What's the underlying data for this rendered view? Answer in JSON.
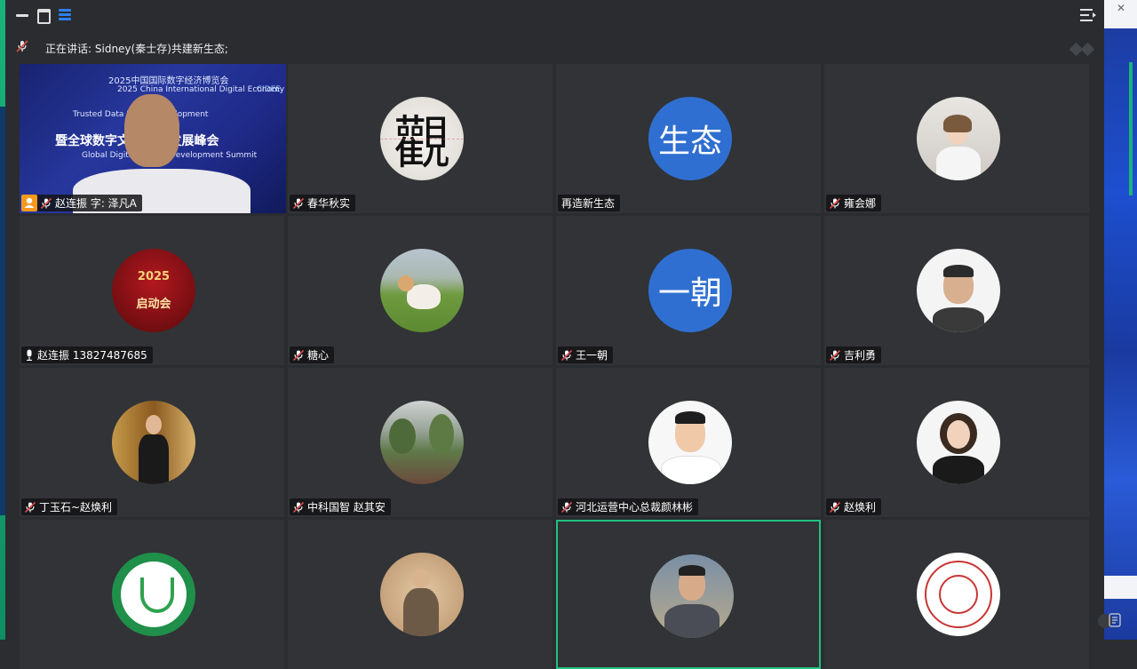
{
  "speaker_bar": {
    "prefix": "正在讲话:",
    "speaker": "Sidney(秦士存)共建新生态;"
  },
  "video_overlay": {
    "line1": "2025中国国际数字经济博览会",
    "line2": "2025 China International Digital Economy Expo",
    "line3": "Trusted Data Emp... Development",
    "line4": "暨全球数字文...(A) 发展峰会",
    "line5": "Global Digital Cultu... Development Summit",
    "logo": "CIDEE"
  },
  "participants": [
    {
      "name": "赵连振 字: 泽凡A",
      "avatar": "video",
      "mic": "off",
      "host": true
    },
    {
      "name": "春华秋实",
      "avatar": "calligraphy",
      "avatar_text": "觀",
      "mic": "off"
    },
    {
      "name": "再造新生态",
      "avatar": "initials",
      "avatar_text": "生态",
      "avatar_color": "#2f6fd1",
      "mic": "none"
    },
    {
      "name": "雍会娜",
      "avatar": "photo-woman",
      "mic": "off"
    },
    {
      "name": "赵连振 13827487685",
      "avatar": "poster",
      "avatar_text": "2025",
      "avatar_sub": "启动会",
      "mic": "on"
    },
    {
      "name": "糖心",
      "avatar": "photo-dog",
      "mic": "off"
    },
    {
      "name": "王一朝",
      "avatar": "initials",
      "avatar_text": "一朝",
      "avatar_color": "#2f6fd1",
      "mic": "off"
    },
    {
      "name": "吉利勇",
      "avatar": "photo-man",
      "mic": "off"
    },
    {
      "name": "丁玉石~赵焕利",
      "avatar": "photo-suit",
      "mic": "off"
    },
    {
      "name": "中科国智  赵其安",
      "avatar": "photo-garden",
      "mic": "off"
    },
    {
      "name": "河北运营中心总裁颜林彬",
      "avatar": "photo-smile",
      "mic": "off"
    },
    {
      "name": "赵焕利",
      "avatar": "photo-woman2",
      "mic": "off"
    },
    {
      "name": "",
      "avatar": "logo-green",
      "mic": "none"
    },
    {
      "name": "",
      "avatar": "painting",
      "mic": "none"
    },
    {
      "name": "",
      "avatar": "photo-man2",
      "mic": "none",
      "active": true
    },
    {
      "name": "",
      "avatar": "seal-red",
      "mic": "none"
    }
  ],
  "colors": {
    "accent_green": "#1fc27e",
    "initials_blue": "#2f6fd1",
    "host_orange": "#f39a1e",
    "mic_off_red": "#e04b4b"
  },
  "icons": [
    "minimize-icon",
    "maximize-icon",
    "layout-icon",
    "menu-icon",
    "mic-off-icon",
    "mic-on-icon",
    "host-icon"
  ]
}
